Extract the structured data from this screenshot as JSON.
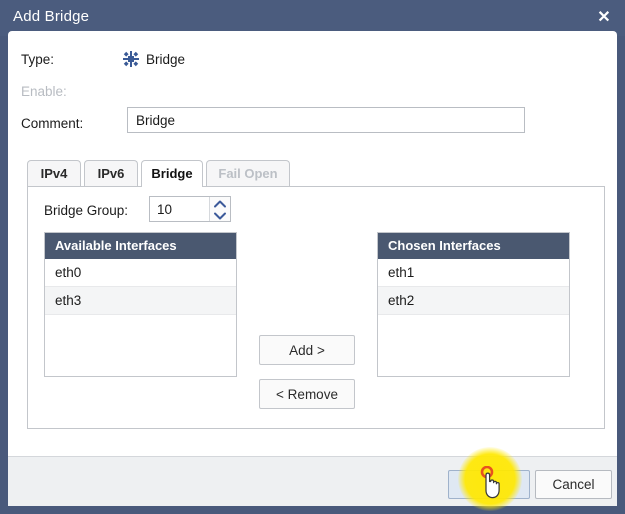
{
  "window": {
    "title": "Add Bridge",
    "close_label": "✕",
    "close_icon": "close-icon"
  },
  "form": {
    "type_label": "Type:",
    "type_value": "Bridge",
    "type_icon": "bridge-node-icon",
    "enable_label": "Enable:",
    "enable_checked": true,
    "enable_disabled": true,
    "comment_label": "Comment:",
    "comment_value": "Bridge",
    "comment_placeholder": ""
  },
  "tabs": [
    {
      "label": "IPv4",
      "state": "inactive"
    },
    {
      "label": "IPv6",
      "state": "inactive"
    },
    {
      "label": "Bridge",
      "state": "active"
    },
    {
      "label": "Fail Open",
      "state": "disabled"
    }
  ],
  "bridge_panel": {
    "group_label": "Bridge Group:",
    "group_value": "10",
    "spinner_up_icon": "chevron-up-icon",
    "spinner_down_icon": "chevron-down-icon",
    "available": {
      "header": "Available Interfaces",
      "rows": [
        "eth0",
        "eth3"
      ]
    },
    "chosen": {
      "header": "Chosen Interfaces",
      "rows": [
        "eth1",
        "eth2"
      ]
    },
    "add_label": "Add >",
    "remove_label": "< Remove"
  },
  "footer": {
    "ok_label": "",
    "cancel_label": "Cancel"
  },
  "colors": {
    "titlebar": "#4b5c7e",
    "frame": "#49597b",
    "list_header": "#4a5870",
    "footer_bg": "#eef0f2",
    "ok_button_bg": "#dfe8f3",
    "click_highlight": "#ffe800",
    "icon_blue": "#3a5a96"
  }
}
